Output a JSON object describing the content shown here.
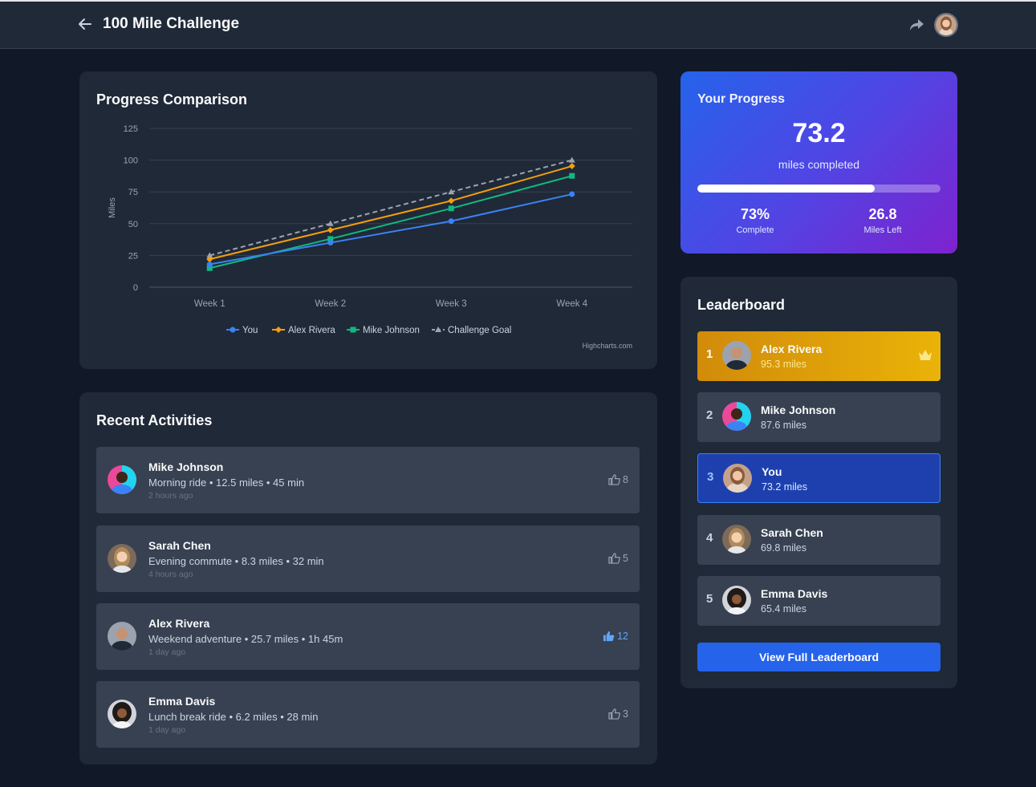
{
  "header": {
    "title": "100 Mile Challenge"
  },
  "chart": {
    "title": "Progress Comparison",
    "credit": "Highcharts.com",
    "yticks": [
      "125",
      "100",
      "75",
      "50",
      "25",
      "0"
    ],
    "colors": {
      "you": "#3b82f6",
      "alex": "#f59e0b",
      "mike": "#10b981",
      "goal": "#9ca3af"
    }
  },
  "chart_data": {
    "type": "line",
    "title": "Progress Comparison",
    "xlabel": "",
    "ylabel": "Miles",
    "categories": [
      "Week 1",
      "Week 2",
      "Week 3",
      "Week 4"
    ],
    "ylim": [
      0,
      125
    ],
    "series": [
      {
        "name": "You",
        "values": [
          18,
          35,
          52,
          73.2
        ]
      },
      {
        "name": "Alex Rivera",
        "values": [
          22,
          45,
          68,
          95.3
        ]
      },
      {
        "name": "Mike Johnson",
        "values": [
          15,
          38,
          62,
          87.6
        ]
      },
      {
        "name": "Challenge Goal",
        "values": [
          25,
          50,
          75,
          100
        ]
      }
    ],
    "legend": "bottom-center",
    "grid": true
  },
  "progress": {
    "title": "Your Progress",
    "value": "73.2",
    "subtitle": "miles completed",
    "fraction": 0.73,
    "percent_value": "73%",
    "percent_label": "Complete",
    "left_value": "26.8",
    "left_label": "Miles Left"
  },
  "leaderboard": {
    "title": "Leaderboard",
    "button": "View Full Leaderboard",
    "rows": [
      {
        "rank": "1",
        "name": "Alex Rivera",
        "miles": "95.3 miles"
      },
      {
        "rank": "2",
        "name": "Mike Johnson",
        "miles": "87.6 miles"
      },
      {
        "rank": "3",
        "name": "You",
        "miles": "73.2 miles"
      },
      {
        "rank": "4",
        "name": "Sarah Chen",
        "miles": "69.8 miles"
      },
      {
        "rank": "5",
        "name": "Emma Davis",
        "miles": "65.4 miles"
      }
    ]
  },
  "activities": {
    "title": "Recent Activities",
    "items": [
      {
        "name": "Mike Johnson",
        "detail": "Morning ride • 12.5 miles • 45 min",
        "time": "2 hours ago",
        "likes": "8"
      },
      {
        "name": "Sarah Chen",
        "detail": "Evening commute • 8.3 miles • 32 min",
        "time": "4 hours ago",
        "likes": "5"
      },
      {
        "name": "Alex Rivera",
        "detail": "Weekend adventure • 25.7 miles • 1h 45m",
        "time": "1 day ago",
        "likes": "12"
      },
      {
        "name": "Emma Davis",
        "detail": "Lunch break ride • 6.2 miles • 28 min",
        "time": "1 day ago",
        "likes": "3"
      }
    ]
  }
}
